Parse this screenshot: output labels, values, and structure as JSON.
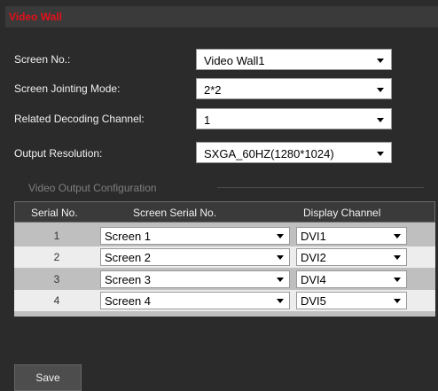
{
  "panel": {
    "title": "Video Wall"
  },
  "form": {
    "screen_no": {
      "label": "Screen No.:",
      "value": "Video Wall1"
    },
    "jointing_mode": {
      "label": "Screen Jointing Mode:",
      "value": "2*2"
    },
    "decoding_channel": {
      "label": "Related Decoding Channel:",
      "value": "1"
    },
    "output_resolution": {
      "label": "Output Resolution:",
      "value": "SXGA_60HZ(1280*1024)"
    }
  },
  "output_config": {
    "section_title": "Video Output Configuration",
    "columns": [
      "Serial No.",
      "Screen Serial No.",
      "Display Channel"
    ],
    "rows": [
      {
        "serial": "1",
        "screen": "Screen 1",
        "channel": "DVI1"
      },
      {
        "serial": "2",
        "screen": "Screen 2",
        "channel": "DVI2"
      },
      {
        "serial": "3",
        "screen": "Screen 3",
        "channel": "DVI4"
      },
      {
        "serial": "4",
        "screen": "Screen 4",
        "channel": "DVI5"
      }
    ]
  },
  "actions": {
    "save_label": "Save"
  },
  "colors": {
    "title_red": "#e0111b",
    "background": "#2b2b2b"
  }
}
